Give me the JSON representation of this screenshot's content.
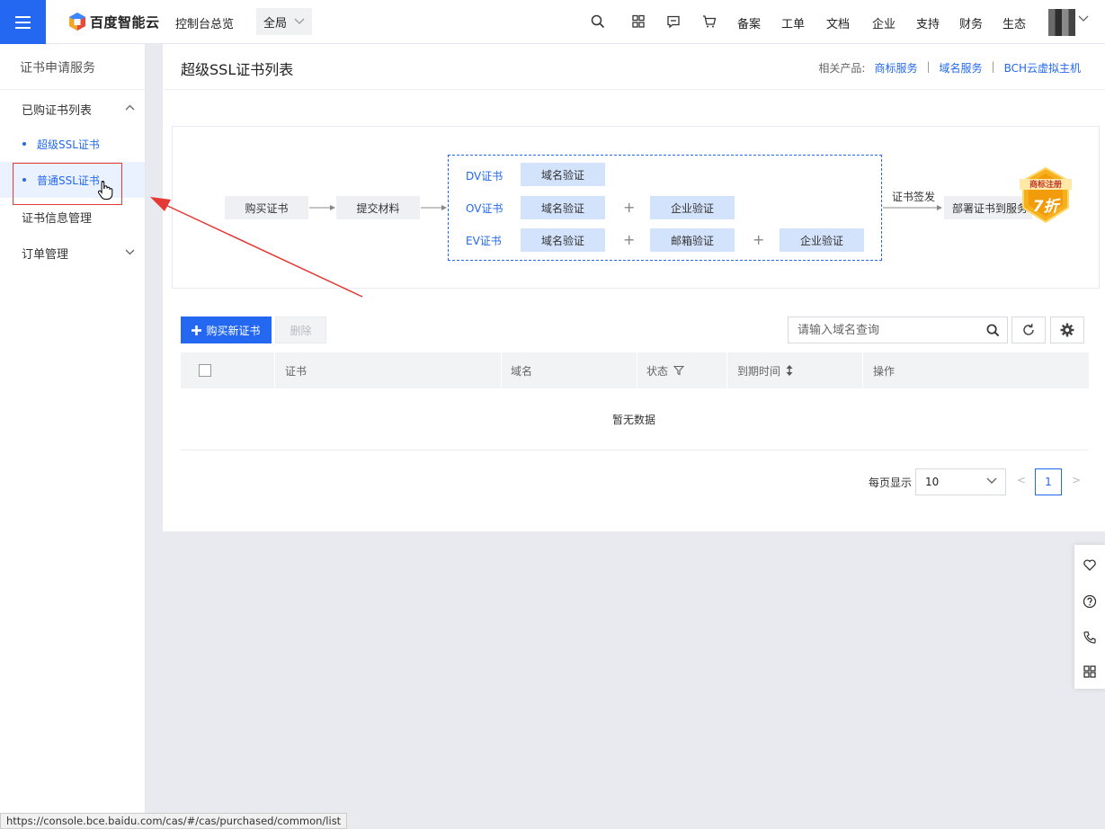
{
  "topbar": {
    "brand": "百度智能云",
    "console_link": "控制台总览",
    "region": "全局",
    "nav": [
      "备案",
      "工单",
      "文档",
      "企业",
      "支持",
      "财务",
      "生态"
    ]
  },
  "sidebar": {
    "title": "证书申请服务",
    "group_purchased": "已购证书列表",
    "sub_super_ssl": "超级SSL证书",
    "sub_normal_ssl": "普通SSL证书",
    "cert_info": "证书信息管理",
    "order_mgmt": "订单管理"
  },
  "main": {
    "title": "超级SSL证书列表",
    "related_label": "相关产品:",
    "related_links": [
      "商标服务",
      "域名服务",
      "BCH云虚拟主机"
    ]
  },
  "flow": {
    "buy": "购买证书",
    "submit": "提交材料",
    "dv": "DV证书",
    "ov": "OV证书",
    "ev": "EV证书",
    "domain_verify": "域名验证",
    "company_verify": "企业验证",
    "email_verify": "邮箱验证",
    "plus": "+",
    "issue": "证书签发",
    "deploy": "部署证书到服务",
    "badge_top": "商标注册",
    "badge_main": "7折"
  },
  "toolbar": {
    "buy_new": "购买新证书",
    "delete": "删除",
    "search_placeholder": "请输入域名查询"
  },
  "table": {
    "columns": [
      "证书",
      "域名",
      "状态",
      "到期时间",
      "操作"
    ],
    "empty": "暂无数据"
  },
  "pagination": {
    "page_size_label": "每页显示",
    "page_size": "10",
    "prev": "<",
    "current_page": "1",
    "next": ">"
  },
  "status_bar": {
    "url": "https://console.bce.baidu.com/cas/#/cas/purchased/common/list"
  },
  "colors": {
    "accent": "#2468f2",
    "annotation": "#e53935"
  }
}
